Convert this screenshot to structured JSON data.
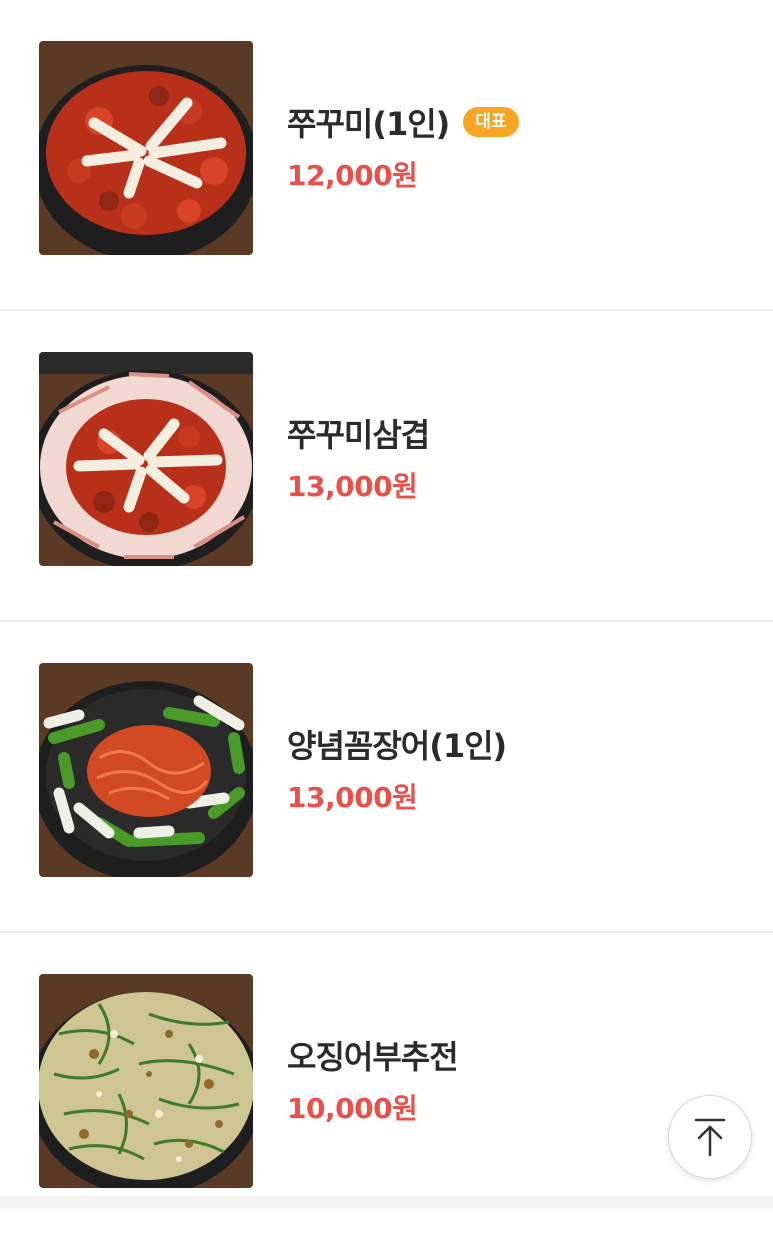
{
  "menu": {
    "items": [
      {
        "name": "쭈꾸미(1인)",
        "badge": "대표",
        "price": "12,000원",
        "image_icon": "jjukkumi-dish-photo"
      },
      {
        "name": "쭈꾸미삼겹",
        "price": "13,000원",
        "image_icon": "jjukkumi-samgyeop-dish-photo"
      },
      {
        "name": "양념꼼장어(1인)",
        "price": "13,000원",
        "image_icon": "kkomjangeo-dish-photo"
      },
      {
        "name": "오징어부추전",
        "price": "10,000원",
        "image_icon": "squid-chive-pancake-photo"
      }
    ]
  },
  "scroll_top": {
    "icon": "arrow-up-to-top-icon"
  },
  "colors": {
    "price": "#e8504a",
    "badge": "#f6a623",
    "divider": "#ececec"
  }
}
